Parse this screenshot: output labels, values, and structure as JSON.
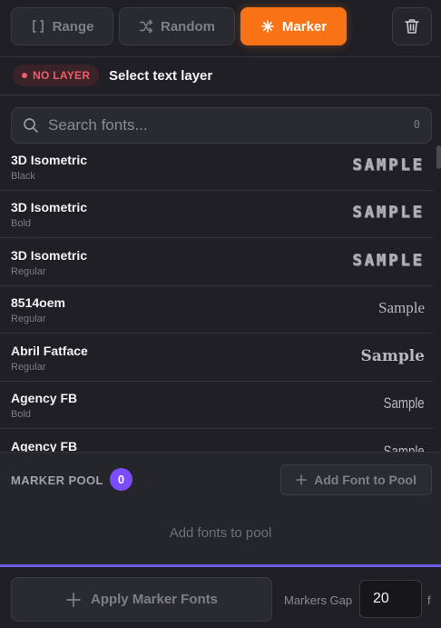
{
  "toolbar": {
    "range_label": "Range",
    "random_label": "Random",
    "marker_label": "Marker"
  },
  "layer": {
    "badge": "NO LAYER",
    "label": "Select text layer"
  },
  "search": {
    "placeholder": "Search fonts...",
    "count": "0"
  },
  "fonts": [
    {
      "name": "3D Isometric",
      "style": "Black",
      "sample": "SAMPLE"
    },
    {
      "name": "3D Isometric",
      "style": "Bold",
      "sample": "SAMPLE"
    },
    {
      "name": "3D Isometric",
      "style": "Regular",
      "sample": "SAMPLE"
    },
    {
      "name": "8514oem",
      "style": "Regular",
      "sample": "Sample"
    },
    {
      "name": "Abril Fatface",
      "style": "Regular",
      "sample": "Sample"
    },
    {
      "name": "Agency FB",
      "style": "Bold",
      "sample": "Sample"
    },
    {
      "name": "Agency FB",
      "style": "",
      "sample": "Sample"
    }
  ],
  "pool": {
    "title": "MARKER POOL",
    "count": "0",
    "add_label": "Add Font to Pool",
    "empty_text": "Add fonts to pool"
  },
  "bottom": {
    "apply_label": "Apply Marker Fonts",
    "gap_label": "Markers Gap",
    "gap_value": "20",
    "gap_unit": "f"
  },
  "colors": {
    "accent_orange": "#f97316",
    "accent_purple": "#7c4dff",
    "error_red": "#f05b6a"
  }
}
